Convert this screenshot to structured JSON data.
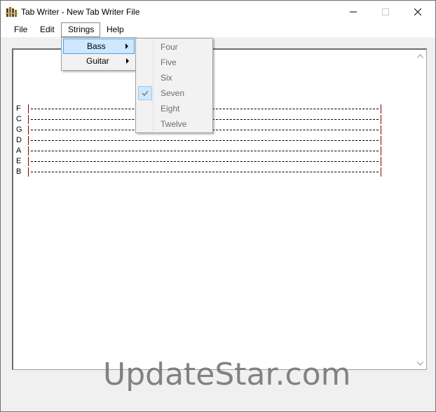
{
  "window": {
    "title": "Tab Writer - New Tab Writer File"
  },
  "menubar": {
    "items": [
      "File",
      "Edit",
      "Strings",
      "Help"
    ]
  },
  "strings_menu": {
    "items": [
      "Bass",
      "Guitar"
    ]
  },
  "bass_submenu": {
    "items": [
      "Four",
      "Five",
      "Six",
      "Seven",
      "Eight",
      "Twelve"
    ],
    "checked": "Seven"
  },
  "tab": {
    "string_labels": [
      "F",
      "C",
      "G",
      "D",
      "A",
      "E",
      "B"
    ]
  },
  "watermark": {
    "text": "UpdateStar.com"
  },
  "colors": {
    "menu_highlight": "#cde8ff",
    "menu_highlight_border": "#4aa0e6",
    "string_bar": "#800000"
  }
}
